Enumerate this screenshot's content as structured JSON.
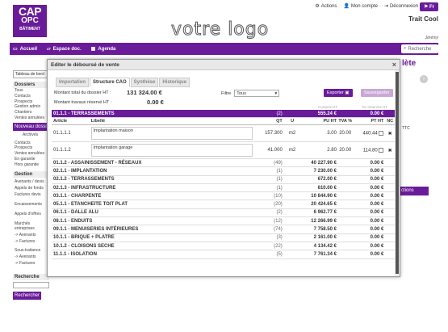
{
  "header": {
    "logo_line1": "CAP",
    "logo_line2": "OPC",
    "logo_line3": "BÂTIMENT",
    "brand": "votre logo",
    "actions_label": "Actions",
    "account_label": "Mon compte",
    "logout_label": "Déconnexion",
    "lang_label": "Fr",
    "company": "Trait Cool",
    "user": "Jérémy"
  },
  "nav": {
    "items": [
      "Accueil",
      "Espace doc.",
      "Agenda"
    ],
    "search_placeholder": "Recherche"
  },
  "sidebar": {
    "select_value": "Tableau de bord",
    "dossiers_title": "Dossiers",
    "dossiers_links": [
      "Tous",
      "Contacts",
      "Prospects",
      "Gestion admin",
      "Chantiers",
      "Ventes annulées"
    ],
    "new_button": "Nouveau dossier",
    "archived": "Archivés",
    "contacts_links": [
      "Contacts",
      "Prospects",
      "Ventes annulées",
      "En garantie",
      "Hors garantie"
    ],
    "gestion_title": "Gestion",
    "gestion_links": [
      "Avenants / devis",
      "Appels de fonds",
      "Factures devis",
      "Encaissements",
      "Appels d'offres",
      "Marchés entreprises",
      "-> Avenants",
      "-> Factures",
      "Sous-traitance",
      "-> Avenants",
      "-> Factures"
    ],
    "recherche_title": "Recherche",
    "recherche_button": "Rechercher"
  },
  "right_stub": {
    "title_fragment": "lète",
    "ttc": "TTC",
    "btn_fragment": "ctions"
  },
  "modal": {
    "title": "Editer le déboursé de vente",
    "close": "×",
    "tabs": [
      "Importation",
      "Structure CAO",
      "Synthèse",
      "Historique"
    ],
    "active_tab": "Structure CAO",
    "total_label": "Montant total du dossier HT :",
    "total_value": "131 324.00 €",
    "reserve_label": "Montant travaux réservé HT :",
    "reserve_value": "0.00 €",
    "filtre_label": "Filtre",
    "filtre_value": "Tous",
    "export_button": "Exporter",
    "save_button": "Sauvegarder",
    "hint_compris": "Compris HT",
    "hint_reserve": "Ex réservés HT",
    "section": {
      "code": "01.1.1 - TERRASSEMENTS",
      "count": "(2)",
      "amount": "555.24 €",
      "reserved": "0.00 €"
    },
    "columns": {
      "article": "Article",
      "libelle": "Libellé",
      "qt": "QT",
      "u": "U",
      "pu": "PU HT",
      "tva": "TVA %",
      "pt": "PT HT",
      "nc": "NC"
    },
    "lines": [
      {
        "article": "01.1.1.1",
        "libelle": "Implantation maison",
        "qt": "157.300",
        "u": "m2",
        "pu": "3.00",
        "tva": "20.00",
        "pt": "440.44"
      },
      {
        "article": "01.1.1.2",
        "libelle": "Implantation garage",
        "qt": "41.000",
        "u": "m2",
        "pu": "2.80",
        "tva": "20.00",
        "pt": "114.80"
      }
    ],
    "groups": [
      {
        "code": "01.1.2 - ASSAINISSEMENT - RÉSEAUX",
        "count": "(49)",
        "amount": "40 227.90 €",
        "reserved": "0.00 €"
      },
      {
        "code": "02.1.1 - IMPLANTATION",
        "count": "(1)",
        "amount": "7 230.00 €",
        "reserved": "0.00 €"
      },
      {
        "code": "02.1.2 - TERRASSEMENTS",
        "count": "(1)",
        "amount": "672.00 €",
        "reserved": "0.00 €"
      },
      {
        "code": "02.1.3 - INFRASTRUCTURE",
        "count": "(1)",
        "amount": "610.00 €",
        "reserved": "0.00 €"
      },
      {
        "code": "03.1.1 - CHARPENTE",
        "count": "(10)",
        "amount": "10 844.90 €",
        "reserved": "0.00 €"
      },
      {
        "code": "05.1.1 - ETANCHEITE TOIT PLAT",
        "count": "(20)",
        "amount": "20 424.65 €",
        "reserved": "0.00 €"
      },
      {
        "code": "06.1.1 - DALLE ALU",
        "count": "(2)",
        "amount": "6 962.77 €",
        "reserved": "0.00 €"
      },
      {
        "code": "08.1.1 - ENDUITS",
        "count": "(12)",
        "amount": "12 266.99 €",
        "reserved": "0.00 €"
      },
      {
        "code": "09.1.1 - MENUISERIES INTÉRIEURES",
        "count": "(74)",
        "amount": "7 758.50 €",
        "reserved": "0.00 €"
      },
      {
        "code": "10.1.1 - BRIQUE + PLATRE",
        "count": "(3)",
        "amount": "2 161.00 €",
        "reserved": "0.00 €"
      },
      {
        "code": "10.1.2 - CLOISONS SECHE",
        "count": "(22)",
        "amount": "4 134.42 €",
        "reserved": "0.00 €"
      },
      {
        "code": "11.1.1 - ISOLATION",
        "count": "(5)",
        "amount": "7 761.34 €",
        "reserved": "0.00 €"
      }
    ]
  },
  "colors": {
    "accent": "#6a1b9a"
  }
}
